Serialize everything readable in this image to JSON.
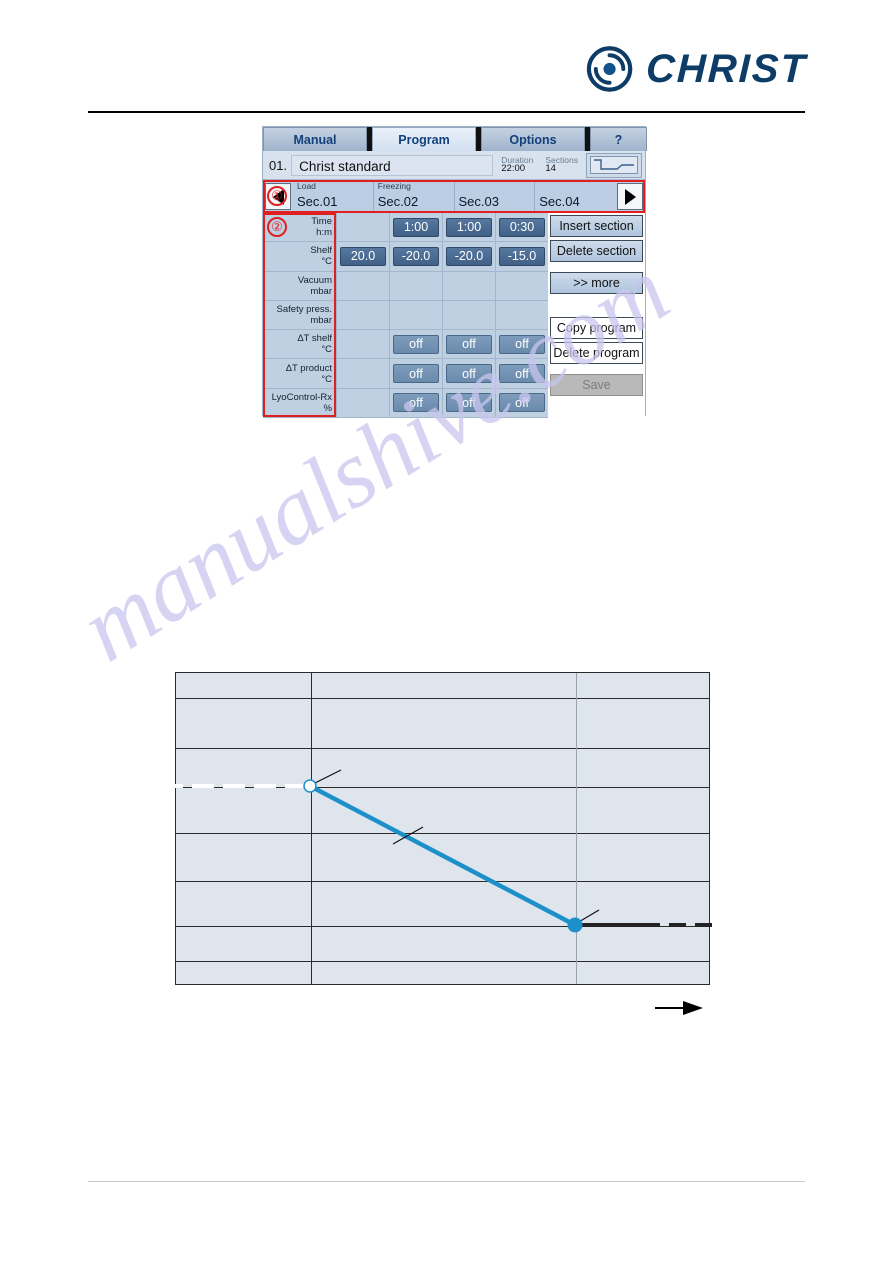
{
  "brand": {
    "name": "CHRIST",
    "logo_mark": "spiral-swirl-icon",
    "color": "#0d3c66"
  },
  "watermark": {
    "text": "manualshive.com"
  },
  "device_screen": {
    "tabs": [
      {
        "label": "Manual",
        "active": false
      },
      {
        "label": "Program",
        "active": true
      },
      {
        "label": "Options",
        "active": false
      },
      {
        "label": "?",
        "active": false
      }
    ],
    "program": {
      "number": "01.",
      "name": "Christ standard",
      "duration_label": "Duration",
      "duration_value": "22:00",
      "sections_label": "Sections",
      "sections_value": "14",
      "thumbnail_icon": "program-curve-icon"
    },
    "navigation": {
      "prev_icon": "arrow-left-icon",
      "prev_label": "Previous sections",
      "next_icon": "arrow-right-icon",
      "next_label": "Next sections"
    },
    "sections": [
      {
        "phase": "Load",
        "name": "Sec.01"
      },
      {
        "phase": "Freezing",
        "name": "Sec.02"
      },
      {
        "phase": "",
        "name": "Sec.03"
      },
      {
        "phase": "",
        "name": "Sec.04"
      }
    ],
    "parameter_rows": [
      {
        "label": "Time",
        "unit": "h:m",
        "values": [
          "",
          "1:00",
          "1:00",
          "0:30"
        ],
        "style": [
          "empty",
          "dark",
          "dark",
          "dark"
        ]
      },
      {
        "label": "Shelf",
        "unit": "°C",
        "values": [
          "20.0",
          "-20.0",
          "-20.0",
          "-15.0"
        ],
        "style": [
          "dark",
          "dark",
          "dark",
          "dark"
        ]
      },
      {
        "label": "Vacuum",
        "unit": "mbar",
        "values": [
          "",
          "",
          "",
          ""
        ],
        "style": [
          "empty",
          "empty",
          "empty",
          "empty"
        ]
      },
      {
        "label": "Safety press.",
        "unit": "mbar",
        "values": [
          "",
          "",
          "",
          ""
        ],
        "style": [
          "empty",
          "empty",
          "empty",
          "empty"
        ]
      },
      {
        "label": "ΔT shelf",
        "unit": "°C",
        "values": [
          "",
          "off",
          "off",
          "off"
        ],
        "style": [
          "empty",
          "light",
          "light",
          "light"
        ]
      },
      {
        "label": "ΔT product",
        "unit": "°C",
        "values": [
          "",
          "off",
          "off",
          "off"
        ],
        "style": [
          "empty",
          "light",
          "light",
          "light"
        ]
      },
      {
        "label": "LyoControl-Rx",
        "unit": "%",
        "values": [
          "",
          "off",
          "off",
          "off"
        ],
        "style": [
          "empty",
          "light",
          "light",
          "light"
        ]
      }
    ],
    "side_buttons": [
      {
        "label": "Insert section",
        "style": "blue",
        "enabled": true
      },
      {
        "label": "Delete section",
        "style": "blue",
        "enabled": true
      },
      {
        "label": ">> more",
        "style": "blue",
        "enabled": true
      },
      {
        "label": "Copy program",
        "style": "white",
        "enabled": true
      },
      {
        "label": "Delete program",
        "style": "white",
        "enabled": true
      },
      {
        "label": "Save",
        "style": "disabled",
        "enabled": false
      }
    ],
    "annotations": [
      {
        "number": "①",
        "target": "section-header-row"
      },
      {
        "number": "②",
        "target": "parameter-row-labels"
      }
    ]
  },
  "chart_data": {
    "type": "line",
    "title": "",
    "xlabel": "",
    "ylabel": "",
    "grid": true,
    "legend": "none",
    "xlim": [
      0,
      535
    ],
    "ylim": [
      0,
      313
    ],
    "gridlines": {
      "horizontal": [
        25,
        75,
        114,
        160,
        208,
        253,
        288
      ],
      "vertical": [
        135,
        400
      ]
    },
    "series": [
      {
        "name": "shelf-temperature-setpoint",
        "color": "#1d8fc9",
        "style": "solid",
        "points": [
          [
            135,
            114
          ],
          [
            400,
            253
          ]
        ],
        "markers": [
          {
            "x": 135,
            "y": 114,
            "fill": "#ffffff",
            "stroke": "#1d8fc9",
            "radius": 6
          },
          {
            "x": 400,
            "y": 253,
            "fill": "#1d8fc9",
            "stroke": "#1d8fc9",
            "radius": 7
          }
        ]
      },
      {
        "name": "setpoint-entry-dashed",
        "color": "#ffffff",
        "style": "dashed",
        "points": [
          [
            20,
            114
          ],
          [
            135,
            114
          ]
        ]
      },
      {
        "name": "hold-segment",
        "color": "#222222",
        "style": "solid-then-dashed",
        "points": [
          [
            400,
            253
          ],
          [
            533,
            253
          ]
        ]
      }
    ],
    "leader_lines": [
      {
        "from": [
          135,
          114
        ],
        "to": [
          162,
          100
        ]
      },
      {
        "from": [
          218,
          172
        ],
        "to": [
          245,
          157
        ]
      },
      {
        "from": [
          400,
          253
        ],
        "to": [
          420,
          240
        ]
      }
    ],
    "flow_arrow": {
      "icon": "arrow-right-icon",
      "direction": "right"
    }
  }
}
